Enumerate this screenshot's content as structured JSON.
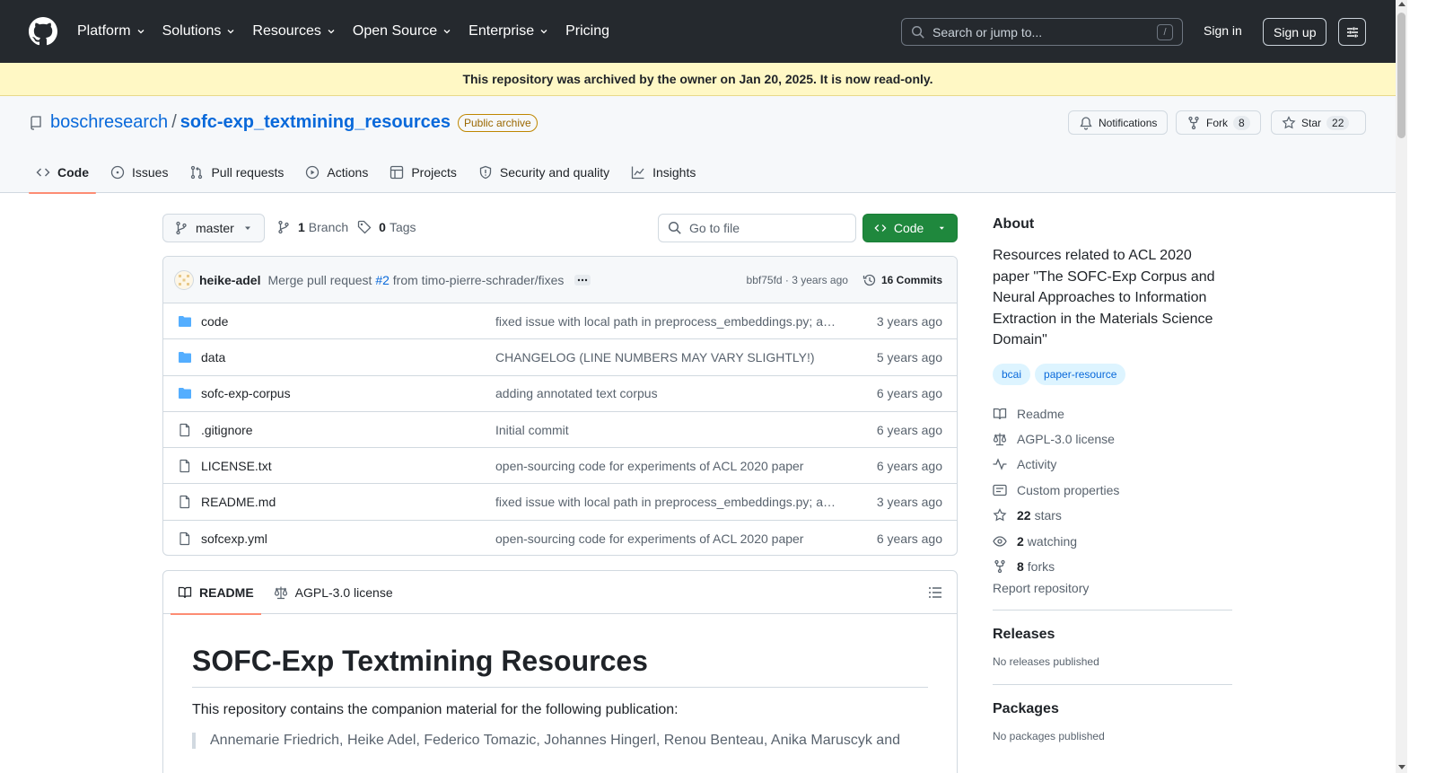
{
  "header": {
    "nav": [
      {
        "label": "Platform",
        "dropdown": true
      },
      {
        "label": "Solutions",
        "dropdown": true
      },
      {
        "label": "Resources",
        "dropdown": true
      },
      {
        "label": "Open Source",
        "dropdown": true
      },
      {
        "label": "Enterprise",
        "dropdown": true
      },
      {
        "label": "Pricing",
        "dropdown": false
      }
    ],
    "search_placeholder": "Search or jump to...",
    "search_shortcut": "/",
    "signin": "Sign in",
    "signup": "Sign up"
  },
  "banner": "This repository was archived by the owner on Jan 20, 2025. It is now read-only.",
  "repo": {
    "owner": "boschresearch",
    "separator": "/",
    "name": "sofc-exp_textmining_resources",
    "badge": "Public archive",
    "notifications": "Notifications",
    "fork_label": "Fork",
    "fork_count": "8",
    "star_label": "Star",
    "star_count": "22"
  },
  "tabs": [
    {
      "label": "Code",
      "icon": "code-icon",
      "active": true
    },
    {
      "label": "Issues",
      "icon": "issue-icon"
    },
    {
      "label": "Pull requests",
      "icon": "pull-request-icon"
    },
    {
      "label": "Actions",
      "icon": "play-icon"
    },
    {
      "label": "Projects",
      "icon": "table-icon"
    },
    {
      "label": "Security and quality",
      "icon": "shield-icon"
    },
    {
      "label": "Insights",
      "icon": "graph-icon"
    }
  ],
  "toolbar": {
    "branch": "master",
    "branch_count": "1",
    "branch_word": "Branch",
    "tag_count": "0",
    "tag_word": "Tags",
    "goto_placeholder": "Go to file",
    "code_label": "Code"
  },
  "commit": {
    "author": "heike-adel",
    "msg_prefix": "Merge pull request ",
    "pr": "#2",
    "msg_suffix": " from timo-pierre-schrader/fixes",
    "meta": "bbf75fd · 3 years ago",
    "commits": "16 Commits"
  },
  "files": [
    {
      "type": "folder",
      "name": "code",
      "message": "fixed issue with local path in preprocess_embeddings.py; ad…",
      "date": "3 years ago"
    },
    {
      "type": "folder",
      "name": "data",
      "message": "CHANGELOG (LINE NUMBERS MAY VARY SLIGHTLY!)",
      "date": "5 years ago"
    },
    {
      "type": "folder",
      "name": "sofc-exp-corpus",
      "message": "adding annotated text corpus",
      "date": "6 years ago"
    },
    {
      "type": "file",
      "name": ".gitignore",
      "message": "Initial commit",
      "date": "6 years ago"
    },
    {
      "type": "file",
      "name": "LICENSE.txt",
      "message": "open-sourcing code for experiments of ACL 2020 paper",
      "date": "6 years ago"
    },
    {
      "type": "file",
      "name": "README.md",
      "message": "fixed issue with local path in preprocess_embeddings.py; ad…",
      "date": "3 years ago"
    },
    {
      "type": "file",
      "name": "sofcexp.yml",
      "message": "open-sourcing code for experiments of ACL 2020 paper",
      "date": "6 years ago"
    }
  ],
  "readme": {
    "tab_readme": "README",
    "tab_license": "AGPL-3.0 license",
    "title": "SOFC-Exp Textmining Resources",
    "intro": "This repository contains the companion material for the following publication:",
    "quote": "Annemarie Friedrich, Heike Adel, Federico Tomazic, Johannes Hingerl, Renou Benteau, Anika Maruscyk and"
  },
  "about": {
    "heading": "About",
    "description": "Resources related to ACL 2020 paper \"The SOFC-Exp Corpus and Neural Approaches to Information Extraction in the Materials Science Domain\"",
    "topics": [
      "bcai",
      "paper-resource"
    ],
    "readme": "Readme",
    "license": "AGPL-3.0 license",
    "activity": "Activity",
    "custom_props": "Custom properties",
    "stars_n": "22",
    "stars_w": "stars",
    "watching_n": "2",
    "watching_w": "watching",
    "forks_n": "8",
    "forks_w": "forks",
    "report": "Report repository"
  },
  "releases": {
    "heading": "Releases",
    "empty": "No releases published"
  },
  "packages": {
    "heading": "Packages",
    "empty": "No packages published"
  },
  "colors": {
    "header_bg": "#25292e",
    "banner_bg": "#fff8c5",
    "accent": "#0969da",
    "code_green": "#1f883d",
    "tab_underline": "#fd8c73"
  }
}
